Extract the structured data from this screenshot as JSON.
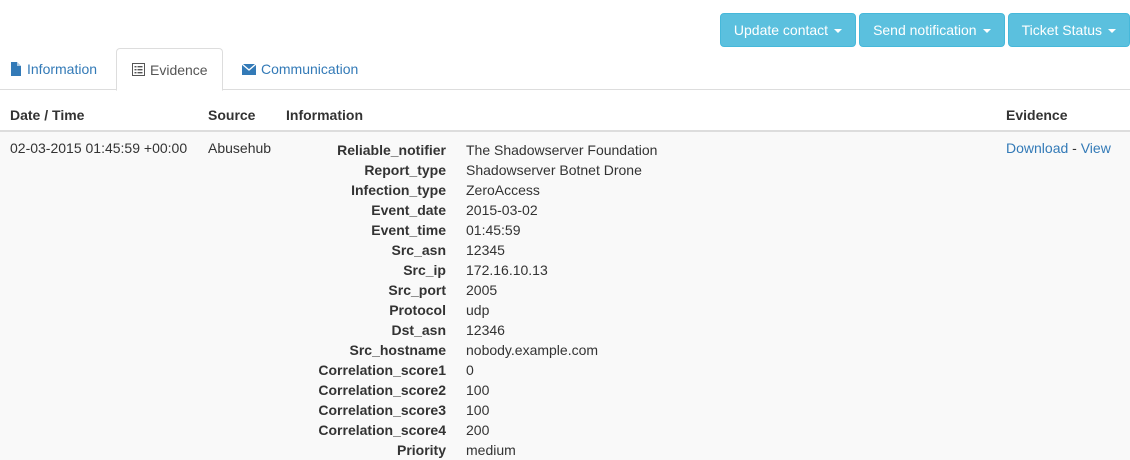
{
  "actions": {
    "update_contact": "Update contact",
    "send_notification": "Send notification",
    "ticket_status": "Ticket Status"
  },
  "tabs": [
    {
      "label": "Information",
      "icon": "file-icon"
    },
    {
      "label": "Evidence",
      "icon": "list-alt-icon",
      "active": true
    },
    {
      "label": "Communication",
      "icon": "envelope-icon"
    }
  ],
  "table": {
    "headers": {
      "date": "Date / Time",
      "source": "Source",
      "information": "Information",
      "evidence": "Evidence"
    },
    "row": {
      "date": "02-03-2015 01:45:59 +00:00",
      "source": "Abusehub",
      "download": "Download",
      "separator": "-",
      "view": "View",
      "information": [
        {
          "key": "Reliable_notifier",
          "value": "The Shadowserver Foundation"
        },
        {
          "key": "Report_type",
          "value": "Shadowserver Botnet Drone"
        },
        {
          "key": "Infection_type",
          "value": "ZeroAccess"
        },
        {
          "key": "Event_date",
          "value": "2015-03-02"
        },
        {
          "key": "Event_time",
          "value": "01:45:59"
        },
        {
          "key": "Src_asn",
          "value": "12345"
        },
        {
          "key": "Src_ip",
          "value": "172.16.10.13"
        },
        {
          "key": "Src_port",
          "value": "2005"
        },
        {
          "key": "Protocol",
          "value": "udp"
        },
        {
          "key": "Dst_asn",
          "value": "12346"
        },
        {
          "key": "Src_hostname",
          "value": "nobody.example.com"
        },
        {
          "key": "Correlation_score1",
          "value": "0"
        },
        {
          "key": "Correlation_score2",
          "value": "100"
        },
        {
          "key": "Correlation_score3",
          "value": "100"
        },
        {
          "key": "Correlation_score4",
          "value": "200"
        },
        {
          "key": "Priority",
          "value": "medium"
        }
      ]
    }
  },
  "colors": {
    "info_button": "#5bc0de",
    "link": "#337ab7",
    "border": "#dddddd",
    "row_stripe": "#f9f9f9"
  }
}
